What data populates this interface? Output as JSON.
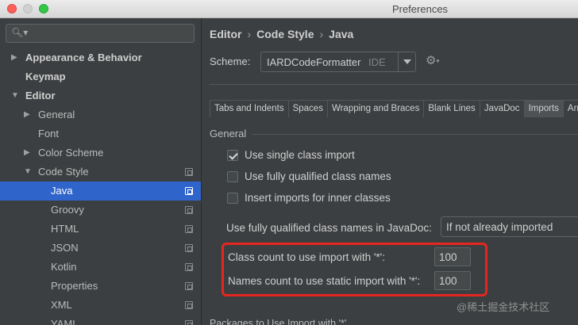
{
  "window": {
    "title": "Preferences"
  },
  "search": {
    "placeholder": "",
    "value": ""
  },
  "sidebar": {
    "items": [
      {
        "label": "Appearance & Behavior",
        "expandable": true,
        "expanded": false,
        "level": 0,
        "bold": true
      },
      {
        "label": "Keymap",
        "expandable": false,
        "level": 0,
        "bold": true
      },
      {
        "label": "Editor",
        "expandable": true,
        "expanded": true,
        "level": 0,
        "bold": true
      },
      {
        "label": "General",
        "expandable": true,
        "expanded": false,
        "level": 1
      },
      {
        "label": "Font",
        "expandable": false,
        "level": 1
      },
      {
        "label": "Color Scheme",
        "expandable": true,
        "expanded": false,
        "level": 1
      },
      {
        "label": "Code Style",
        "expandable": true,
        "expanded": true,
        "level": 1,
        "copy_icon": true
      },
      {
        "label": "Java",
        "level": 2,
        "selected": true,
        "copy_icon": true
      },
      {
        "label": "Groovy",
        "level": 2,
        "copy_icon": true
      },
      {
        "label": "HTML",
        "level": 2,
        "copy_icon": true
      },
      {
        "label": "JSON",
        "level": 2,
        "copy_icon": true
      },
      {
        "label": "Kotlin",
        "level": 2,
        "copy_icon": true
      },
      {
        "label": "Properties",
        "level": 2,
        "copy_icon": true
      },
      {
        "label": "XML",
        "level": 2,
        "copy_icon": true
      },
      {
        "label": "YAML",
        "level": 2,
        "copy_icon": true
      }
    ]
  },
  "breadcrumb": [
    "Editor",
    "Code Style",
    "Java"
  ],
  "scheme": {
    "label": "Scheme:",
    "value": "IARDCodeFormatter",
    "tag": "IDE"
  },
  "tabs": [
    {
      "label": "Tabs and Indents"
    },
    {
      "label": "Spaces"
    },
    {
      "label": "Wrapping and Braces"
    },
    {
      "label": "Blank Lines"
    },
    {
      "label": "JavaDoc"
    },
    {
      "label": "Imports",
      "active": true
    },
    {
      "label": "Arr"
    }
  ],
  "general": {
    "title": "General",
    "checkboxes": [
      {
        "label": "Use single class import",
        "checked": true
      },
      {
        "label": "Use fully qualified class names",
        "checked": false
      },
      {
        "label": "Insert imports for inner classes",
        "checked": false
      }
    ],
    "javadoc_label": "Use fully qualified class names in JavaDoc:",
    "javadoc_value": "If not already imported",
    "class_count_label": "Class count to use import with '*':",
    "class_count_value": "100",
    "names_count_label": "Names count to use static import with '*':",
    "names_count_value": "100"
  },
  "packages_title": "Packages to Use Import with '*'",
  "watermark": "@稀土掘金技术社区",
  "colors": {
    "accent": "#2f65ca",
    "highlight": "#e5261f",
    "background": "#3c3f41"
  }
}
